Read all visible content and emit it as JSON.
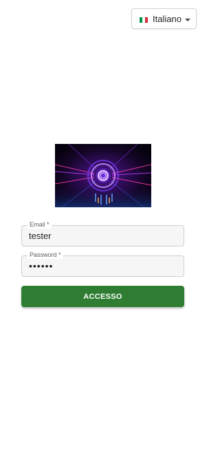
{
  "language_selector": {
    "label": "Italiano",
    "flag_icon": "italy-flag-icon",
    "caret_icon": "caret-down-icon",
    "flag_colors": [
      "#009246",
      "#ffffff",
      "#ce2b37"
    ]
  },
  "hero_image": {
    "icon": "glowing-portal-image",
    "colors": {
      "background": "#06020d",
      "glow": "#a04bff",
      "accent": "#ff3ba8"
    }
  },
  "form": {
    "email": {
      "label": "Email *",
      "value": "tester"
    },
    "password": {
      "label": "Password *",
      "value": "••••••"
    },
    "submit_label": "ACCESSO"
  },
  "colors": {
    "primary": "#2e7d32",
    "field_background": "#f6f6f6",
    "field_border": "#cfcfcf"
  }
}
